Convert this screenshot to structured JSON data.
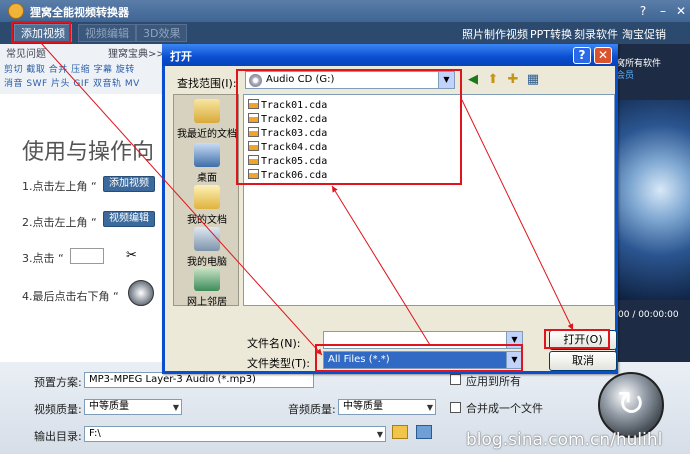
{
  "app": {
    "title": "狸窝全能视频转换器",
    "toolbar": {
      "add_video": "添加视频",
      "edit_video": "视频编辑",
      "effects": "3D效果",
      "links": [
        "照片制作视频",
        "PPT转换",
        "刻录软件",
        "淘宝促销"
      ]
    },
    "left_tabs": [
      "常见问题",
      "狸窝宝典>>"
    ],
    "feature_rows": [
      "剪切 截取 合并 压缩 字幕 旋转",
      "消音 SWF 片头 GIF 双音轨 MV"
    ],
    "right_info": [
      "窝所有软件",
      "会员"
    ],
    "time": "00 / 00:00:00",
    "guide": {
      "heading": "使用与操作向",
      "step1": "1.点击左上角 “",
      "step1_btn": "添加视频",
      "step2": "2.点击左上角 “",
      "step2_btn": "视频编辑",
      "step3": "3.点击 “",
      "step4": "4.最后点击右下角 “"
    },
    "bottom": {
      "preset_label": "预置方案:",
      "preset_value": "MP3-MPEG Layer-3 Audio (*.mp3)",
      "video_quality_label": "视频质量:",
      "video_quality_value": "中等质量",
      "audio_quality_label": "音频质量:",
      "audio_quality_value": "中等质量",
      "apply_all": "应用到所有",
      "merge_label": "合并成一个文件",
      "output_label": "输出目录:",
      "output_value": "F:\\"
    },
    "watermark": "blog.sina.com.cn/hulihl"
  },
  "dialog": {
    "title": "打开",
    "look_in_label": "查找范围(I):",
    "look_in_value": "Audio CD (G:)",
    "places": [
      "我最近的文档",
      "桌面",
      "我的文档",
      "我的电脑",
      "网上邻居"
    ],
    "files": [
      "Track01.cda",
      "Track02.cda",
      "Track03.cda",
      "Track04.cda",
      "Track05.cda",
      "Track06.cda"
    ],
    "filename_label": "文件名(N):",
    "filename_value": "",
    "filetype_label": "文件类型(T):",
    "filetype_value": "All Files (*.*)",
    "open_btn": "打开(O)",
    "cancel_btn": "取消"
  },
  "colors": {
    "highlight": "#e0141c",
    "dialog_title": "#0a4ed0",
    "toolbar": "#2c4a6e"
  }
}
